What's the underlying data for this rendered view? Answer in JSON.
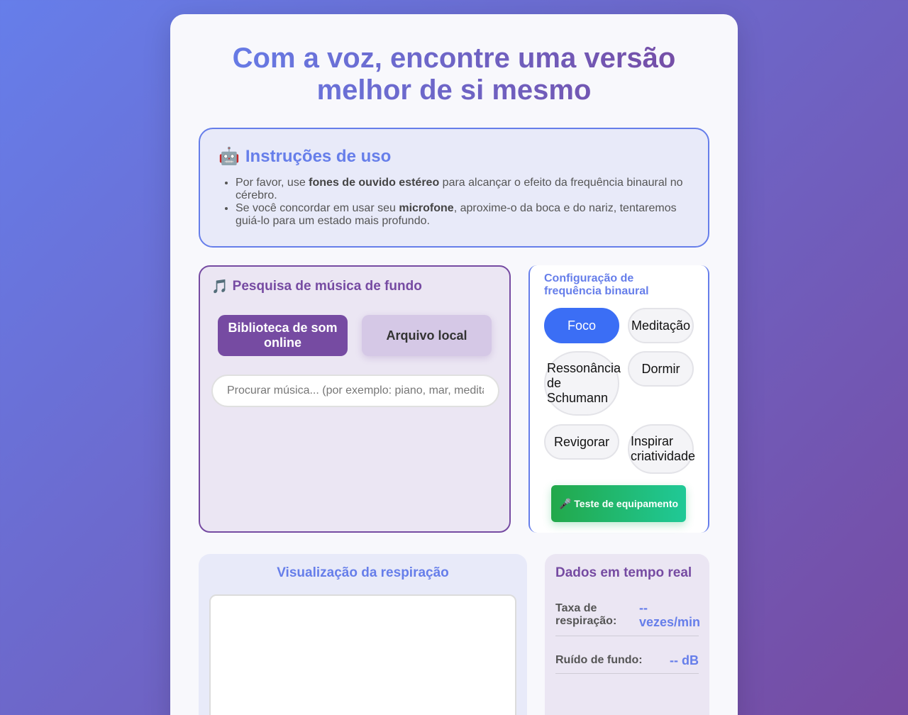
{
  "page": {
    "title": "Com a voz, encontre uma versão melhor de si mesmo"
  },
  "instructions": {
    "icon": "robot-icon",
    "emoji": "🤖",
    "heading": "Instruções de uso",
    "item1_pre": "Por favor, use ",
    "item1_bold": "fones de ouvido estéreo",
    "item1_post": " para alcançar o efeito da frequência binaural no cérebro.",
    "item2_pre": "Se você concordar em usar seu ",
    "item2_bold": "microfone",
    "item2_post": ", aproxime-o da boca e do nariz, tentaremos guiá-lo para um estado mais profundo."
  },
  "music": {
    "icon": "music-note-icon",
    "emoji": "🎵",
    "heading": "Pesquisa de música de fundo",
    "btn_library": "Biblioteca de som online",
    "btn_local": "Arquivo local",
    "search_placeholder": "Procurar música... (por exemplo: piano, mar, meditação)",
    "search_value": ""
  },
  "binaural": {
    "heading": "Configuração de frequência binaural",
    "options": [
      "Foco",
      "Meditação",
      "Ressonância de Schumann",
      "Dormir",
      "Revigorar",
      "Inspirar criatividade"
    ],
    "selected": "Foco",
    "test_icon": "microphone-icon",
    "test_button": "🎤 Teste de equipamento"
  },
  "visualization": {
    "heading": "Visualização da respiração"
  },
  "realtime": {
    "heading": "Dados em tempo real",
    "breath_label": "Taxa de respiração:",
    "breath_value": "-- vezes/min",
    "noise_label": "Ruído de fundo:",
    "noise_value": "-- dB"
  },
  "colors": {
    "primary": "#667eea",
    "secondary": "#764ba2",
    "active": "#3b6ef5",
    "success": "#22a84a"
  }
}
